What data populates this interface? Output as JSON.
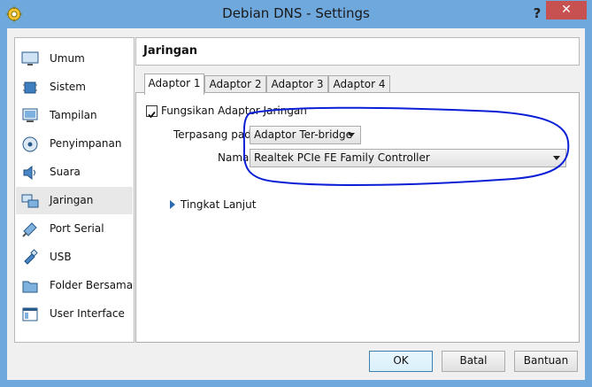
{
  "window": {
    "title": "Debian DNS - Settings",
    "help_label": "?",
    "close_label": "✕",
    "accent": "#6fa8dc"
  },
  "sidebar": {
    "items": [
      {
        "label": "Umum",
        "icon": "monitor-icon"
      },
      {
        "label": "Sistem",
        "icon": "chip-icon"
      },
      {
        "label": "Tampilan",
        "icon": "display-icon"
      },
      {
        "label": "Penyimpanan",
        "icon": "disk-icon"
      },
      {
        "label": "Suara",
        "icon": "speaker-icon"
      },
      {
        "label": "Jaringan",
        "icon": "network-icon",
        "selected": true
      },
      {
        "label": "Port Serial",
        "icon": "serial-port-icon"
      },
      {
        "label": "USB",
        "icon": "usb-icon"
      },
      {
        "label": "Folder Bersama",
        "icon": "folder-icon"
      },
      {
        "label": "User Interface",
        "icon": "window-icon"
      }
    ]
  },
  "page": {
    "title": "Jaringan"
  },
  "tabs": [
    "Adaptor 1",
    "Adaptor 2",
    "Adaptor 3",
    "Adaptor 4"
  ],
  "adapter": {
    "enable_label": "Fungsikan Adaptor Jaringan",
    "enabled": true,
    "attached_label": "Terpasang pada:",
    "attached_value": "Adaptor Ter-bridge",
    "name_label": "Nama:",
    "name_value": "Realtek PCIe FE Family Controller",
    "advanced_label": "Tingkat Lanjut"
  },
  "buttons": {
    "ok": "OK",
    "cancel": "Batal",
    "help": "Bantuan"
  }
}
